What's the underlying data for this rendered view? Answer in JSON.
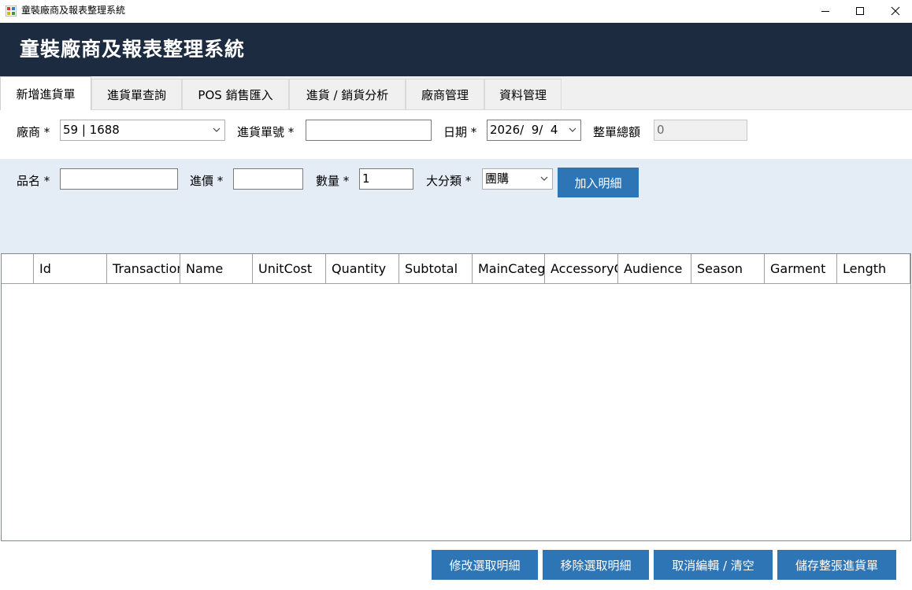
{
  "window": {
    "title": "童裝廠商及報表整理系統",
    "minimize_icon": "minimize-icon",
    "maximize_icon": "maximize-icon",
    "close_icon": "close-icon"
  },
  "header": {
    "title": "童裝廠商及報表整理系統"
  },
  "tabs": [
    {
      "label": "新增進貨單",
      "active": true
    },
    {
      "label": "進貨單查詢",
      "active": false
    },
    {
      "label": "POS 銷售匯入",
      "active": false
    },
    {
      "label": "進貨 / 銷貨分析",
      "active": false
    },
    {
      "label": "廠商管理",
      "active": false
    },
    {
      "label": "資料管理",
      "active": false
    }
  ],
  "order_form": {
    "vendor_label": "廠商 *",
    "vendor_value": "59 | 1688",
    "order_no_label": "進貨單號 *",
    "order_no_value": "",
    "date_label": "日期 *",
    "date_value": "2026/  9/  4",
    "total_label": "整單總額",
    "total_value": "0"
  },
  "detail_form": {
    "item_name_label": "品名 *",
    "item_name_value": "",
    "cost_label": "進價 *",
    "cost_value": "",
    "quantity_label": "數量 *",
    "quantity_value": "1",
    "category_label": "大分類 *",
    "category_value": "團購",
    "add_button": "加入明細"
  },
  "grid": {
    "columns": [
      "Id",
      "Transaction",
      "Name",
      "UnitCost",
      "Quantity",
      "Subtotal",
      "MainCategory",
      "AccessoryCategory",
      "Audience",
      "Season",
      "Garment",
      "Length"
    ],
    "rows": []
  },
  "actions": {
    "edit_selected": "修改選取明細",
    "remove_selected": "移除選取明細",
    "cancel_clear": "取消編輯 / 清空",
    "save_order": "儲存整張進貨單"
  },
  "colors": {
    "header_bg": "#1d2b40",
    "accent_button": "#2e75b6",
    "detail_band_bg": "#e4ecf6"
  }
}
